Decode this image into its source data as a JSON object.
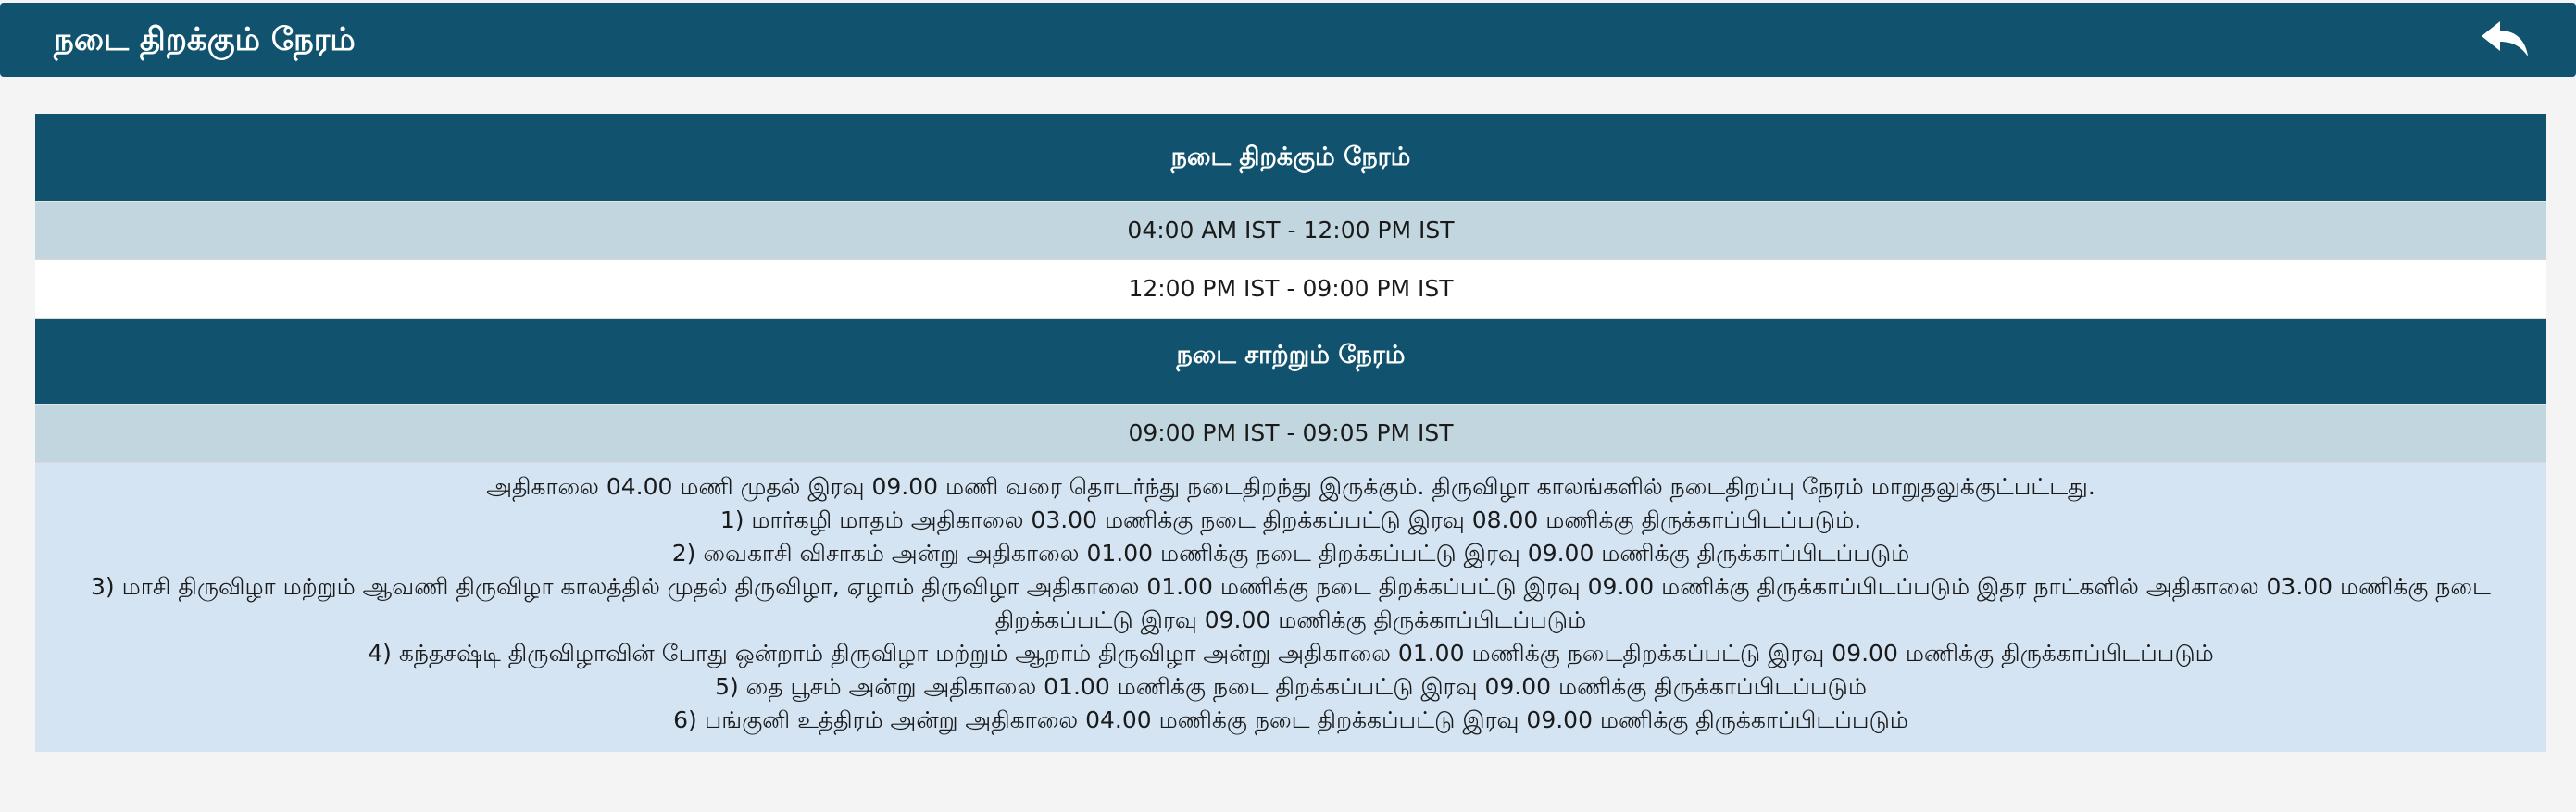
{
  "header": {
    "title": "நடை திறக்கும் நேரம்",
    "back_icon": "reply-arrow-icon"
  },
  "opening": {
    "title": "நடை திறக்கும் நேரம்",
    "times": [
      "04:00 AM IST - 12:00 PM IST",
      "12:00 PM IST - 09:00 PM IST"
    ]
  },
  "closing": {
    "title": "நடை சாற்றும் நேரம்",
    "times": [
      "09:00 PM IST - 09:05 PM IST"
    ]
  },
  "notes": [
    "அதிகாலை 04.00 மணி முதல் இரவு 09.00 மணி வரை தொடர்ந்து நடைதிறந்து இருக்கும். திருவிழா காலங்களில் நடைதிறப்பு நேரம் மாறுதலுக்குட்பட்டது.",
    "1) மார்கழி மாதம் அதிகாலை 03.00 மணிக்கு நடை திறக்கப்பட்டு இரவு 08.00 மணிக்கு திருக்காப்பிடப்படும்.",
    "2) வைகாசி விசாகம் அன்று அதிகாலை 01.00 மணிக்கு நடை திறக்கப்பட்டு இரவு 09.00 மணிக்கு திருக்காப்பிடப்படும்",
    "3) மாசி திருவிழா மற்றும் ஆவணி திருவிழா காலத்தில் முதல் திருவிழா, ஏழாம் திருவிழா அதிகாலை 01.00 மணிக்கு நடை திறக்கப்பட்டு இரவு 09.00 மணிக்கு திருக்காப்பிடப்படும் இதர நாட்களில் அதிகாலை 03.00 மணிக்கு நடை திறக்கப்பட்டு இரவு 09.00 மணிக்கு திருக்காப்பிடப்படும்",
    "4) கந்தசஷ்டி திருவிழாவின் போது ஒன்றாம் திருவிழா மற்றும் ஆறாம் திருவிழா அன்று அதிகாலை 01.00 மணிக்கு நடைதிறக்கப்பட்டு இரவு 09.00 மணிக்கு திருக்காப்பிடப்படும்",
    "5) தை பூசம் அன்று அதிகாலை 01.00 மணிக்கு நடை திறக்கப்பட்டு இரவு 09.00 மணிக்கு திருக்காப்பிடப்படும்",
    "6) பங்குனி உத்திரம் அன்று அதிகாலை 04.00 மணிக்கு நடை திறக்கப்பட்டு இரவு 09.00 மணிக்கு திருக்காப்பிடப்படும்"
  ],
  "colors": {
    "header_bg": "#11536e",
    "row_shaded": "#c1d6df",
    "notes_bg": "#d4e4f3",
    "page_bg": "#f4f4f4"
  }
}
